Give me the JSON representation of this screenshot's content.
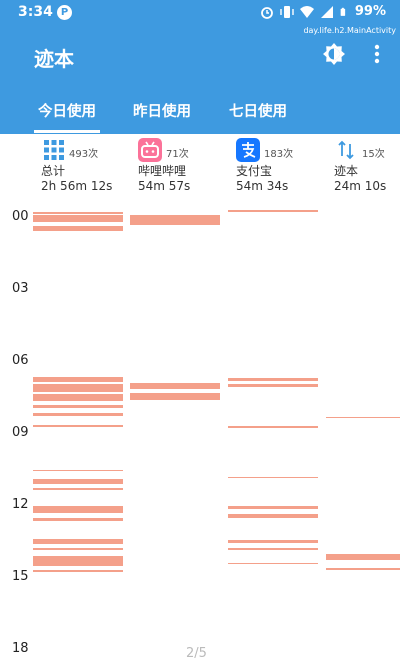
{
  "status_bar": {
    "time": "3:34",
    "battery": "99%",
    "activity": "day.life.h2.MainActivity"
  },
  "app": {
    "title": "迹本"
  },
  "tabs": [
    {
      "label": "今日使用",
      "active": true
    },
    {
      "label": "昨日使用",
      "active": false
    },
    {
      "label": "七日使用",
      "active": false
    }
  ],
  "columns": [
    {
      "icon": "grid-icon",
      "count": "493次",
      "name": "总计",
      "duration": "2h 56m 12s"
    },
    {
      "icon": "bilibili-icon",
      "count": "71次",
      "name": "哔哩哔哩",
      "duration": "54m 57s"
    },
    {
      "icon": "alipay-icon",
      "count": "183次",
      "name": "支付宝",
      "duration": "54m 34s"
    },
    {
      "icon": "sort-icon",
      "count": "15次",
      "name": "迹本",
      "duration": "24m 10s"
    }
  ],
  "hour_labels": [
    "00",
    "03",
    "06",
    "09",
    "12",
    "15",
    "18"
  ],
  "usage_timeline": {
    "bar_color": "#f4a08a",
    "sessions": [
      [
        [
          0.15,
          0.25
        ],
        [
          0.3,
          0.6
        ],
        [
          0.75,
          0.95
        ],
        [
          7.05,
          7.25
        ],
        [
          7.35,
          7.65
        ],
        [
          7.75,
          8.05
        ],
        [
          8.2,
          8.35
        ],
        [
          8.55,
          8.65
        ],
        [
          9.05,
          9.12
        ],
        [
          10.9,
          10.95
        ],
        [
          11.3,
          11.5
        ],
        [
          11.65,
          11.75
        ],
        [
          12.4,
          12.7
        ],
        [
          12.9,
          13.05
        ],
        [
          13.8,
          14.0
        ],
        [
          14.15,
          14.25
        ],
        [
          14.5,
          14.9
        ],
        [
          15.1,
          15.15
        ]
      ],
      [
        [
          0.3,
          0.7
        ],
        [
          7.3,
          7.55
        ],
        [
          7.7,
          8.0
        ]
      ],
      [
        [
          0.1,
          0.18
        ],
        [
          7.1,
          7.2
        ],
        [
          7.35,
          7.45
        ],
        [
          9.1,
          9.16
        ],
        [
          11.2,
          11.25
        ],
        [
          12.4,
          12.55
        ],
        [
          12.75,
          12.9
        ],
        [
          13.85,
          13.95
        ],
        [
          14.15,
          14.25
        ],
        [
          14.8,
          14.85
        ]
      ],
      [
        [
          8.7,
          8.72
        ],
        [
          14.4,
          14.65
        ],
        [
          15.0,
          15.08
        ]
      ]
    ]
  },
  "pagination": "2/5"
}
